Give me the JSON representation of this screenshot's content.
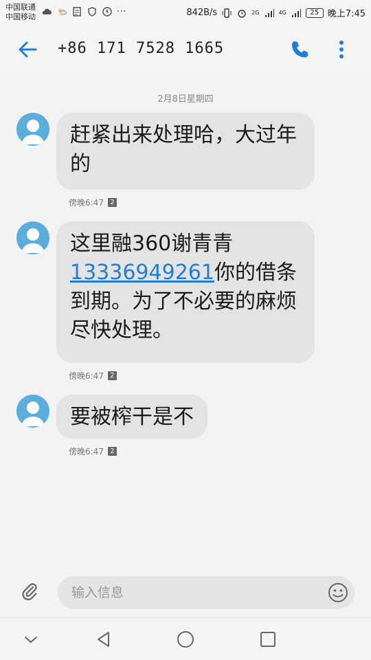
{
  "status_bar": {
    "carrier_1": "中国联通",
    "carrier_2": "中国移动",
    "net_speed": "842B/s",
    "signal_1_label": "2G",
    "signal_2_label": "4G",
    "battery": "25",
    "time": "晚上7:45"
  },
  "header": {
    "contact_number": "+86 171 7528 1665",
    "back_icon": "arrow-left",
    "call_icon": "phone",
    "more_icon": "vertical-dots",
    "accent_color": "#1d7fd8"
  },
  "thread": {
    "date_separator": "2月8日星期四",
    "messages": [
      {
        "text": "赶紧出来处理哈，大过年的",
        "time": "傍晚6:47",
        "sim": "2"
      },
      {
        "text_before_link": "这里融360谢青青",
        "link": "13336949261",
        "text_after_link": "你的借条到期。为了不必要的麻烦尽快处理。",
        "time": "傍晚6:47",
        "sim": "2"
      },
      {
        "text": "要被榨干是不",
        "time": "傍晚6:47",
        "sim": "2"
      }
    ]
  },
  "composer": {
    "placeholder": "输入信息",
    "attach_icon": "paperclip",
    "emoji_icon": "smiley"
  },
  "nav_bar": {
    "icons": [
      "chevron-down",
      "back-triangle",
      "home-circle",
      "recents-square"
    ]
  }
}
